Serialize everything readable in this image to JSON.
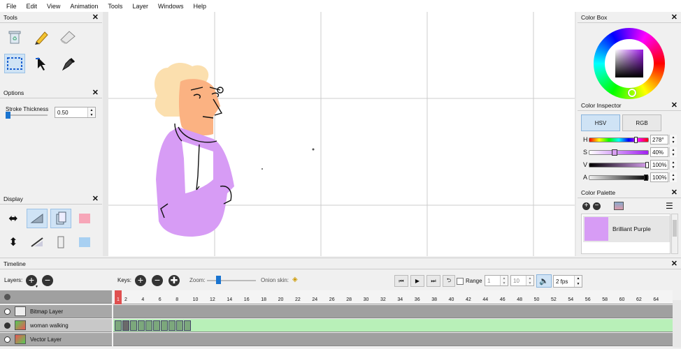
{
  "menu": [
    "File",
    "Edit",
    "View",
    "Animation",
    "Tools",
    "Layer",
    "Windows",
    "Help"
  ],
  "panels": {
    "tools": "Tools",
    "options": "Options",
    "display": "Display",
    "color_box": "Color Box",
    "color_inspector": "Color Inspector",
    "color_palette": "Color Palette",
    "timeline": "Timeline"
  },
  "options": {
    "stroke_label": "Stroke Thickness",
    "stroke_value": "0.50"
  },
  "inspector": {
    "tabs": [
      "HSV",
      "RGB"
    ],
    "active_tab": "HSV",
    "channels": [
      {
        "label": "H",
        "value": "278°",
        "level": 0.77
      },
      {
        "label": "S",
        "value": "40%",
        "level": 0.4
      },
      {
        "label": "V",
        "value": "100%",
        "level": 1.0
      },
      {
        "label": "A",
        "value": "100%",
        "level": 1.0
      }
    ]
  },
  "palette": {
    "swatch_name": "Brilliant Purple",
    "swatch_color": "#d79cf5"
  },
  "timeline": {
    "layers_label": "Layers:",
    "keys_label": "Keys:",
    "zoom_label": "Zoom:",
    "onion_label": "Onion skin:",
    "range_label": "Range",
    "range_start": "1",
    "range_end": "10",
    "fps": "2 fps",
    "current_frame": "1",
    "ruler_numbers": [
      "2",
      "4",
      "6",
      "8",
      "10",
      "12",
      "14",
      "16",
      "18",
      "20",
      "22",
      "24",
      "26",
      "28",
      "30",
      "32",
      "34",
      "36",
      "38",
      "40",
      "42",
      "44",
      "46",
      "48",
      "50",
      "52",
      "54",
      "56",
      "58",
      "60",
      "62",
      "64"
    ],
    "layers": [
      {
        "name": "Bitmap Layer",
        "visible": false
      },
      {
        "name": "woman walking",
        "visible": true
      },
      {
        "name": "Vector Layer",
        "visible": false
      }
    ]
  },
  "colors": {
    "accent": "#d8a0f0",
    "selected": "#cfe3f5",
    "frames": "#b8f0b8"
  }
}
